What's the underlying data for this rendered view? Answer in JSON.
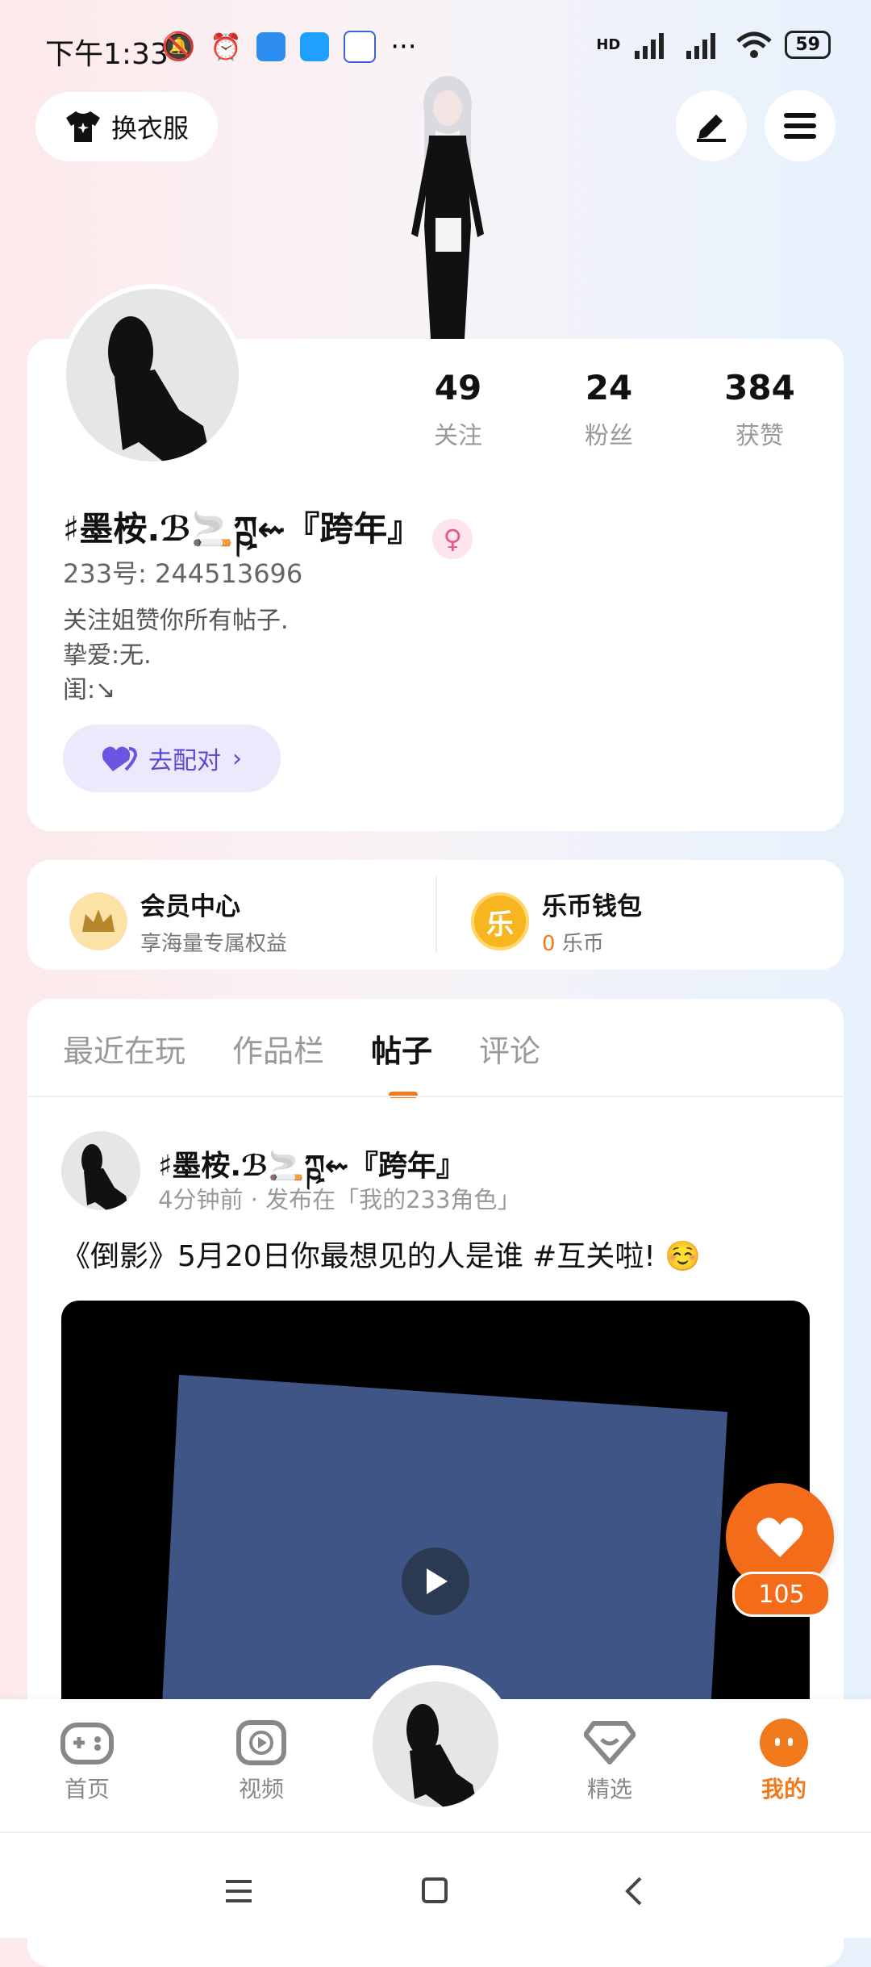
{
  "status_bar": {
    "time": "下午1:33",
    "network": "HD",
    "battery": "59",
    "left_icons": [
      "mute-icon",
      "alarm-icon",
      "cloud-app-icon",
      "app-icon",
      "baidu-icon",
      "more-icon"
    ],
    "more": "···"
  },
  "top": {
    "outfit_label": "换衣服"
  },
  "profile": {
    "stats": [
      {
        "num": "49",
        "label": "关注"
      },
      {
        "num": "24",
        "label": "粉丝"
      },
      {
        "num": "384",
        "label": "获赞"
      }
    ],
    "username": "♯墨桉.ℬ🚬ཀྵ⇜『跨年』",
    "gender_symbol": "♀",
    "uid": "233号: 244513696",
    "bio": [
      "关注姐赞你所有帖子.",
      "挚爱:无.",
      "闺:↘"
    ],
    "pair_label": "去配对"
  },
  "member": {
    "vip_title": "会员中心",
    "vip_sub": "享海量专属权益",
    "wallet_title": "乐币钱包",
    "wallet_amount": "0",
    "wallet_unit": "乐币",
    "coin_char": "乐"
  },
  "tabs": [
    "最近在玩",
    "作品栏",
    "帖子",
    "评论"
  ],
  "active_tab": "帖子",
  "post": {
    "author": "♯墨桉.ℬ🚬ཀྵ⇜『跨年』",
    "meta": "4分钟前 · 发布在「我的233角色」",
    "text": "《倒影》5月20日你最想见的人是谁 #互关啦! ☺️"
  },
  "like_count": "105",
  "colors": {
    "accent": "#f07a1c",
    "like": "#f36c1a",
    "pair_bg": "#ece9fc",
    "pair_text": "#5a4bd0",
    "media_blue": "#3e5585"
  },
  "nav": [
    {
      "label": "首页",
      "icon": "gamepad-icon"
    },
    {
      "label": "视频",
      "icon": "video-icon"
    },
    {
      "label": "",
      "icon": "avatar"
    },
    {
      "label": "精选",
      "icon": "heart-box-icon"
    },
    {
      "label": "我的",
      "icon": "face-icon"
    }
  ]
}
